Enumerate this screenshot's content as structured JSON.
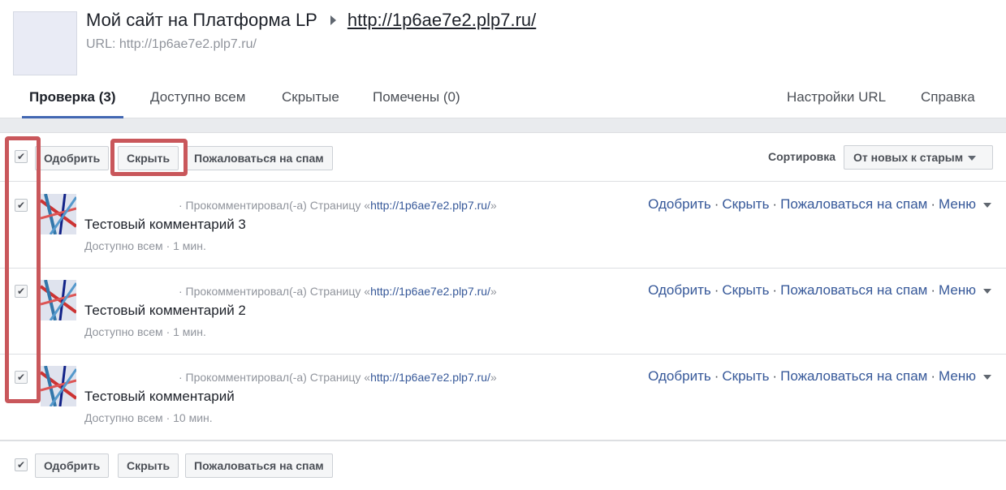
{
  "header": {
    "site_name": "Мой сайт на Платформа LP",
    "site_link": "http://1p6ae7e2.plp7.ru/",
    "url_line": "URL: http://1p6ae7e2.plp7.ru/"
  },
  "tabs": [
    {
      "label": "Проверка (3)",
      "active": true
    },
    {
      "label": "Доступно всем"
    },
    {
      "label": "Скрытые"
    },
    {
      "label": "Помечены (0)"
    },
    {
      "label": "Настройки URL"
    },
    {
      "label": "Справка"
    }
  ],
  "toolbar": {
    "approve": "Одобрить",
    "hide": "Скрыть",
    "spam": "Пожаловаться на спам",
    "sort_label": "Сортировка",
    "sort_value": "От новых к старым",
    "checked": "✔"
  },
  "comments": [
    {
      "meta_prefix": "· Прокомментировал(-а) Страницу «",
      "page_link": "http://1p6ae7e2.plp7.ru/",
      "meta_suffix": "»",
      "text": "Тестовый комментарий 3",
      "status": "Доступно всем · 1 мин.",
      "checked": "✔"
    },
    {
      "meta_prefix": "· Прокомментировал(-а) Страницу «",
      "page_link": "http://1p6ae7e2.plp7.ru/",
      "meta_suffix": "»",
      "text": "Тестовый комментарий 2",
      "status": "Доступно всем · 1 мин.",
      "checked": "✔"
    },
    {
      "meta_prefix": "· Прокомментировал(-а) Страницу «",
      "page_link": "http://1p6ae7e2.plp7.ru/",
      "meta_suffix": "»",
      "text": "Тестовый комментарий",
      "status": "Доступно всем · 10 мин.",
      "checked": "✔"
    }
  ],
  "comment_actions": {
    "approve": "Одобрить",
    "hide": "Скрыть",
    "spam": "Пожаловаться на спам",
    "menu": "Меню",
    "sep": "·"
  },
  "colors": {
    "accent": "#4267b2",
    "link": "#365899",
    "highlight": "#c9575b"
  }
}
